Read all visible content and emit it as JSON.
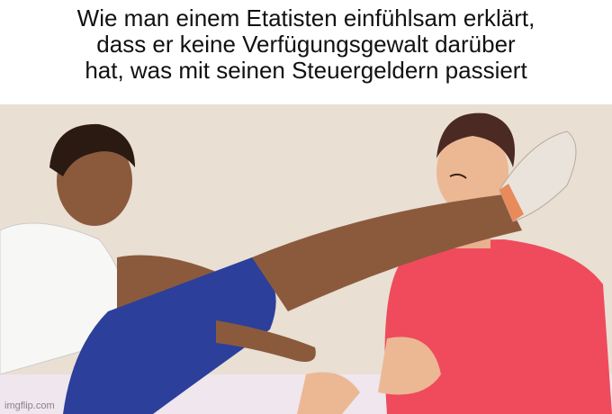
{
  "caption": {
    "lines": [
      "Wie man einem Etatisten einfühlsam erklärt,",
      "dass er keine Verfügungsgewalt darüber",
      "hat, was mit seinen Steuergeldern passiert"
    ]
  },
  "watermark": "imgflip.com",
  "colors": {
    "background": "#e9dfd3",
    "skin_left": "#8b5a3c",
    "shirt_right": "#ef4b5c",
    "shorts": "#2c3f9a",
    "shoe": "#e88a5a"
  }
}
